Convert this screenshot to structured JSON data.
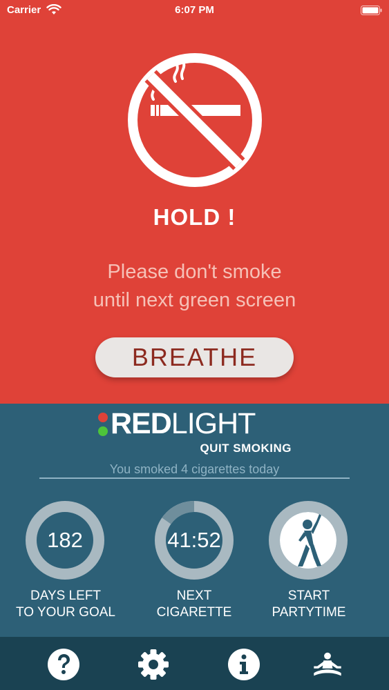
{
  "status": {
    "carrier": "Carrier",
    "time": "6:07 PM"
  },
  "alert": {
    "title": "HOLD !",
    "message_line1": "Please don't smoke",
    "message_line2": "until next green screen",
    "button_label": "BREATHE"
  },
  "brand": {
    "word_bold": "RED",
    "word_light": "LIGHT",
    "tagline": "QUIT SMOKING"
  },
  "summary": {
    "smoked_text": "You smoked 4 cigarettes today"
  },
  "stats": [
    {
      "value": "182",
      "label": "DAYS LEFT\nTO YOUR GOAL"
    },
    {
      "value": "41:52",
      "label": "NEXT\nCIGARETTE"
    },
    {
      "value": "",
      "label": "START\nPARTYTIME"
    }
  ],
  "tabs": [
    {
      "icon": "help-icon"
    },
    {
      "icon": "gear-icon"
    },
    {
      "icon": "info-icon"
    },
    {
      "icon": "meditation-icon"
    }
  ],
  "colors": {
    "alert_red": "#df4238",
    "panel_blue": "#2d6077",
    "tabbar": "#1a4252",
    "ring_gray": "#a9b9c1"
  }
}
